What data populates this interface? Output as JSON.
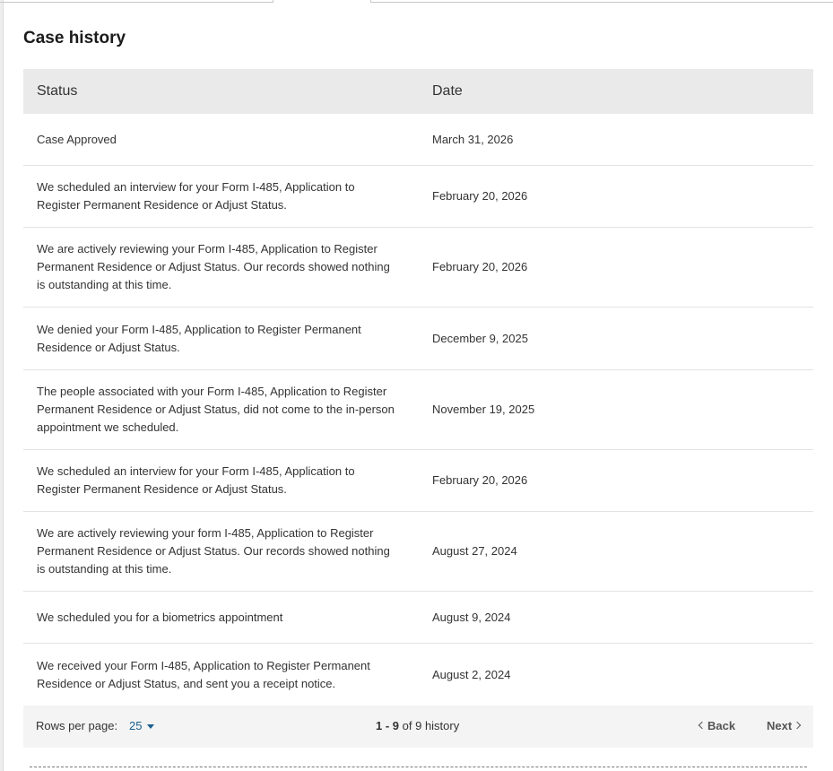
{
  "case_history": {
    "title": "Case history",
    "columns": {
      "status": "Status",
      "date": "Date"
    },
    "rows": [
      {
        "status": "Case Approved",
        "date": "March 31, 2026"
      },
      {
        "status": "We scheduled an interview for your Form I-485, Application to Register Permanent Residence or Adjust Status.",
        "date": "February 20, 2026"
      },
      {
        "status": "We are actively reviewing your Form I-485, Application to Register Permanent Residence or Adjust Status. Our records showed nothing is outstanding at this time.",
        "date": "February 20, 2026"
      },
      {
        "status": "We denied your Form I-485, Application to Register Permanent Residence or Adjust Status.",
        "date": "December 9, 2025"
      },
      {
        "status": "The people associated with your Form I-485, Application to Register Permanent Residence or Adjust Status, did not come to the in-person appointment we scheduled.",
        "date": "November 19, 2025"
      },
      {
        "status": "We scheduled an interview for your Form I-485, Application to Register Permanent Residence or Adjust Status.",
        "date": "February 20, 2026"
      },
      {
        "status": "We are actively reviewing your form I-485, Application to Register Permanent Residence or Adjust Status. Our records showed nothing is outstanding at this time.",
        "date": "August 27, 2024"
      },
      {
        "status": "We scheduled you for a biometrics appointment",
        "date": "August 9, 2024"
      },
      {
        "status": "We received your Form I-485, Application to Register Permanent Residence or Adjust Status, and sent you a receipt notice.",
        "date": "August 2, 2024"
      }
    ]
  },
  "pagination": {
    "rows_per_page_label": "Rows per page:",
    "rows_per_page_value": "25",
    "range_start": "1",
    "range_sep": " - ",
    "range_end": "9",
    "range_suffix": " of 9 history",
    "back_label": "Back",
    "next_label": "Next"
  },
  "colors": {
    "header_bg": "#eaeaea",
    "footer_bg": "#f4f4f4",
    "link": "#1a5f8f",
    "text": "#333333"
  }
}
